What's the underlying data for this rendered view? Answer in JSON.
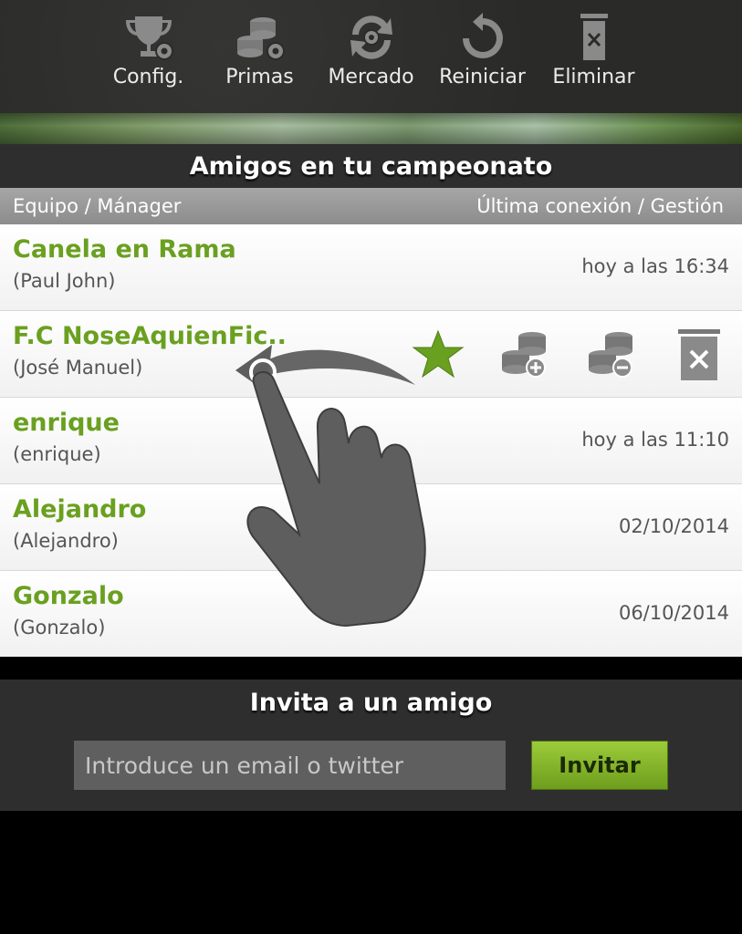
{
  "toolbar": {
    "items": [
      {
        "label": "Config.",
        "icon": "trophy-gear-icon"
      },
      {
        "label": "Primas",
        "icon": "coins-gear-icon"
      },
      {
        "label": "Mercado",
        "icon": "refresh-gear-icon"
      },
      {
        "label": "Reiniciar",
        "icon": "restart-icon"
      },
      {
        "label": "Eliminar",
        "icon": "trash-icon"
      }
    ]
  },
  "section": {
    "title": "Amigos en tu campeonato",
    "col_left": "Equipo / Mánager",
    "col_right": "Última conexión / Gestión"
  },
  "friends": [
    {
      "team": "Canela en Rama",
      "manager": "(Paul John)",
      "last": "hoy a las 16:34"
    },
    {
      "team": "F.C NoseAquienFic..",
      "manager": "(José Manuel)",
      "last": ""
    },
    {
      "team": "enrique",
      "manager": "(enrique)",
      "last": "hoy a las 11:10"
    },
    {
      "team": "Alejandro",
      "manager": "(Alejandro)",
      "last": "02/10/2014"
    },
    {
      "team": "Gonzalo",
      "manager": "(Gonzalo)",
      "last": "06/10/2014"
    }
  ],
  "row_actions": [
    "star-icon",
    "coins-add-icon",
    "coins-remove-icon",
    "trash-icon"
  ],
  "invite": {
    "title": "Invita a un amigo",
    "placeholder": "Introduce un email o twitter",
    "button": "Invitar"
  },
  "colors": {
    "team_green": "#6aa020",
    "button_green": "#8fbf30",
    "dark_bg": "#2e2e2e"
  }
}
